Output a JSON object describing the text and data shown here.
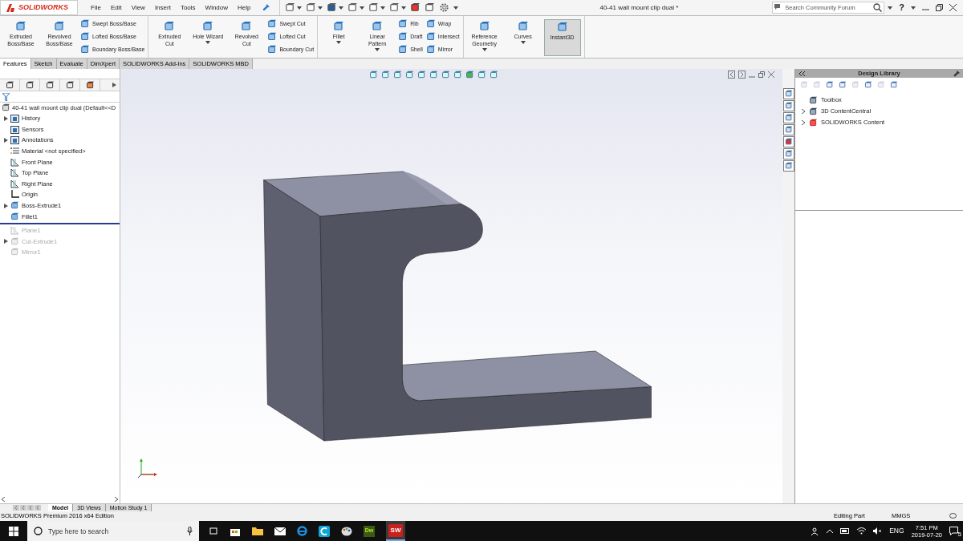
{
  "titlebar": {
    "logo": "SOLIDWORKS",
    "menu": [
      "File",
      "Edit",
      "View",
      "Insert",
      "Tools",
      "Window",
      "Help"
    ],
    "document_title": "40-41 wall mount clip dual *",
    "search": {
      "placeholder": "Search Community Forum"
    },
    "help": "?"
  },
  "ribbon": [
    {
      "large": [
        {
          "label": "Extruded Boss/Base",
          "dropdown": false,
          "selected": false
        },
        {
          "label": "Revolved Boss/Base",
          "dropdown": false,
          "selected": false
        }
      ],
      "columns": [
        [
          "Swept Boss/Base",
          "Lofted Boss/Base",
          "Boundary Boss/Base"
        ]
      ]
    },
    {
      "large": [
        {
          "label": "Extruded Cut",
          "dropdown": false,
          "selected": false
        },
        {
          "label": "Hole Wizard",
          "dropdown": true,
          "selected": false
        },
        {
          "label": "Revolved Cut",
          "dropdown": false,
          "selected": false
        }
      ],
      "columns": [
        [
          "Swept Cut",
          "Lofted Cut",
          "Boundary Cut"
        ]
      ]
    },
    {
      "large": [
        {
          "label": "Fillet",
          "dropdown": true,
          "selected": false
        },
        {
          "label": "Linear Pattern",
          "dropdown": true,
          "selected": false
        }
      ],
      "columns": [
        [
          "Rib",
          "Draft",
          "Shell"
        ],
        [
          "Wrap",
          "Intersect",
          "Mirror"
        ]
      ]
    },
    {
      "large": [
        {
          "label": "Reference Geometry",
          "dropdown": true,
          "selected": false
        },
        {
          "label": "Curves",
          "dropdown": true,
          "selected": false
        },
        {
          "label": "Instant3D",
          "dropdown": false,
          "selected": true
        }
      ]
    }
  ],
  "command_tabs": [
    {
      "label": "Features",
      "selected": true
    },
    {
      "label": "Sketch",
      "selected": false
    },
    {
      "label": "Evaluate",
      "selected": false
    },
    {
      "label": "DimXpert",
      "selected": false
    },
    {
      "label": "SOLIDWORKS Add-Ins",
      "selected": false
    },
    {
      "label": "SOLIDWORKS MBD",
      "selected": false
    }
  ],
  "feature_tree": {
    "root": "40-41 wall mount clip dual  (Default<<D",
    "items": [
      {
        "kind": "folder",
        "label": "History",
        "expandable": true,
        "suppressed": false
      },
      {
        "kind": "folder",
        "label": "Sensors",
        "expandable": false,
        "suppressed": false
      },
      {
        "kind": "folder",
        "label": "Annotations",
        "expandable": true,
        "suppressed": false
      },
      {
        "kind": "material",
        "label": "Material <not specified>",
        "expandable": false,
        "suppressed": false
      },
      {
        "kind": "plane",
        "label": "Front Plane",
        "expandable": false,
        "suppressed": false
      },
      {
        "kind": "plane",
        "label": "Top Plane",
        "expandable": false,
        "suppressed": false
      },
      {
        "kind": "plane",
        "label": "Right Plane",
        "expandable": false,
        "suppressed": false
      },
      {
        "kind": "origin",
        "label": "Origin",
        "expandable": false,
        "suppressed": false
      },
      {
        "kind": "feature",
        "label": "Boss-Extrude1",
        "expandable": true,
        "suppressed": false
      },
      {
        "kind": "feature",
        "label": "Fillet1",
        "expandable": false,
        "suppressed": false
      },
      {
        "kind": "rollback"
      },
      {
        "kind": "plane",
        "label": "Plane1",
        "expandable": false,
        "suppressed": true
      },
      {
        "kind": "feature",
        "label": "Cut-Extrude1",
        "expandable": true,
        "suppressed": true
      },
      {
        "kind": "feature",
        "label": "Mirror1",
        "expandable": false,
        "suppressed": true
      }
    ]
  },
  "design_library": {
    "title": "Design Library",
    "items": [
      {
        "label": "Toolbox",
        "expandable": false
      },
      {
        "label": "3D ContentCentral",
        "expandable": true
      },
      {
        "label": "SOLIDWORKS Content",
        "expandable": true
      }
    ]
  },
  "bottom_tabs": [
    {
      "label": "Model",
      "selected": true
    },
    {
      "label": "3D Views",
      "selected": false
    },
    {
      "label": "Motion Study 1",
      "selected": false
    }
  ],
  "status_bar": {
    "edition": "SOLIDWORKS Premium 2016 x64 Edition",
    "mode": "Editing Part",
    "units": "MMGS"
  },
  "taskbar": {
    "search": {
      "placeholder": "Type here to search"
    },
    "dw_label": "Dw",
    "sw_label": "SW",
    "language": "ENG",
    "time": "7:51 PM",
    "date": "2019-07-20",
    "notifications": "5"
  }
}
